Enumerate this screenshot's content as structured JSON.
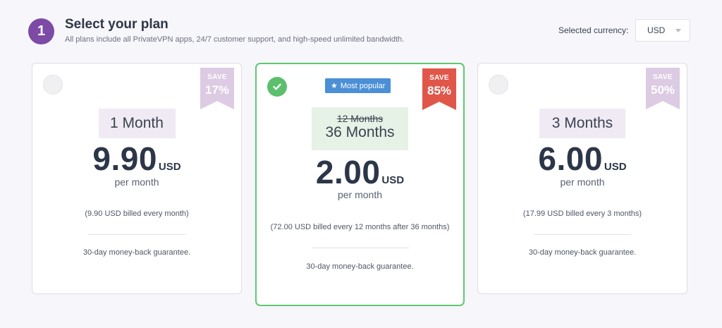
{
  "header": {
    "step": "1",
    "title": "Select your plan",
    "subtitle": "All plans include all PrivateVPN apps, 24/7 customer support, and high-speed unlimited bandwidth.",
    "currency_label": "Selected currency:",
    "currency_value": "USD"
  },
  "plans": [
    {
      "selected": false,
      "save_label": "SAVE",
      "save_pct": "17%",
      "duration": "1 Month",
      "price": "9.90",
      "currency": "USD",
      "per": "per month",
      "billed": "(9.90 USD billed every month)",
      "guarantee": "30-day money-back guarantee."
    },
    {
      "selected": true,
      "badge": "Most popular",
      "save_label": "SAVE",
      "save_pct": "85%",
      "old_duration": "12 Months",
      "duration": "36 Months",
      "price": "2.00",
      "currency": "USD",
      "per": "per month",
      "billed": "(72.00 USD billed every 12 months after 36 months)",
      "guarantee": "30-day money-back guarantee."
    },
    {
      "selected": false,
      "save_label": "SAVE",
      "save_pct": "50%",
      "duration": "3 Months",
      "price": "6.00",
      "currency": "USD",
      "per": "per month",
      "billed": "(17.99 USD billed every 3 months)",
      "guarantee": "30-day money-back guarantee."
    }
  ],
  "colors": {
    "accent_purple": "#7d4aa6",
    "selected_green": "#5fc872",
    "popular_blue": "#4b8fd6",
    "save_red": "#e0574a",
    "save_lilac": "#dccbe3"
  },
  "icons": {
    "selected": "check-icon",
    "badge": "star-icon",
    "dropdown": "chevron-down-icon"
  }
}
